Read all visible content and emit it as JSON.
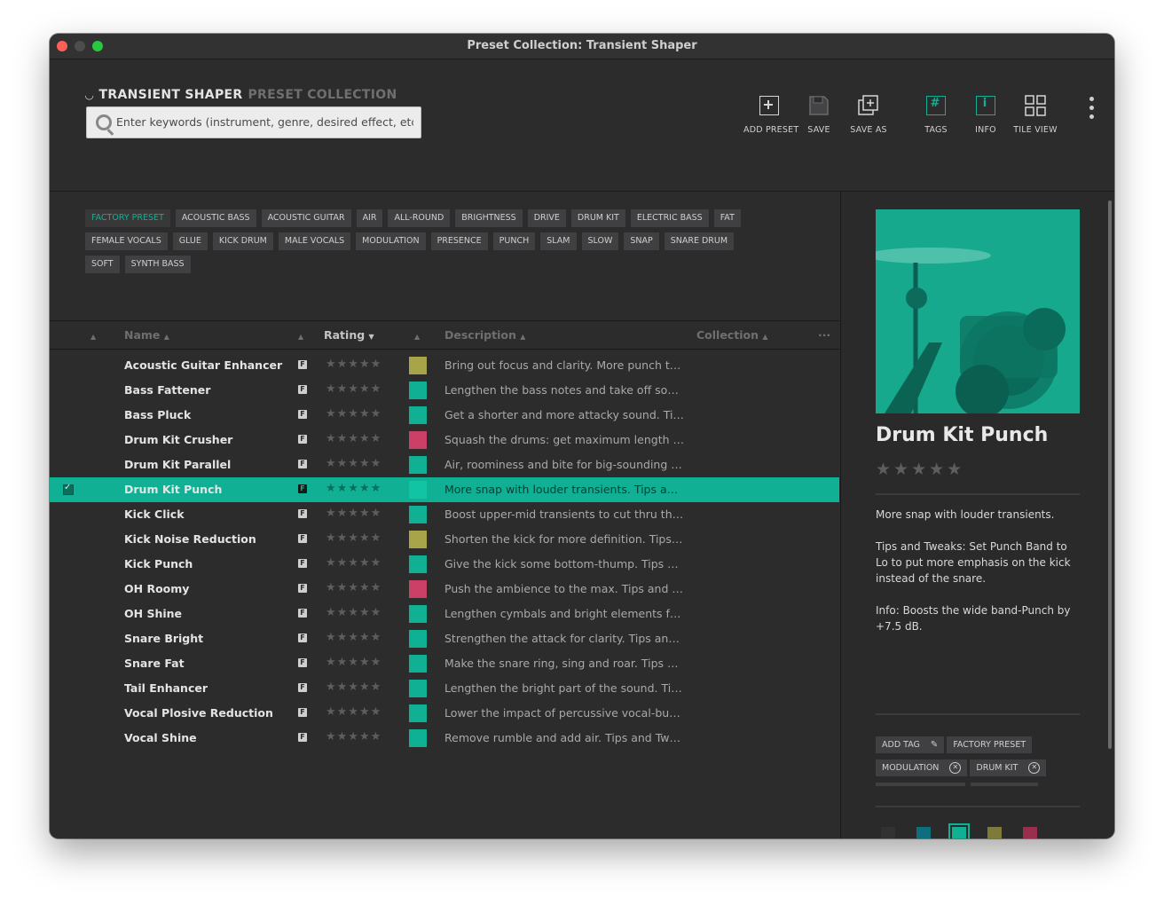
{
  "window": {
    "title": "Preset Collection: Transient Shaper"
  },
  "header": {
    "brand_name": "TRANSIENT SHAPER",
    "brand_sub": "PRESET COLLECTION",
    "search_placeholder": "Enter keywords (instrument, genre, desired effect, etc.)"
  },
  "toolbar": {
    "add_preset": "ADD PRESET",
    "save": "SAVE",
    "save_as": "SAVE AS",
    "tags": "TAGS",
    "tags_glyph": "#",
    "info": "INFO",
    "info_glyph": "i",
    "tile_view": "TILE VIEW"
  },
  "tag_filter": [
    "FACTORY PRESET",
    "ACOUSTIC BASS",
    "ACOUSTIC GUITAR",
    "AIR",
    "ALL-ROUND",
    "BRIGHTNESS",
    "DRIVE",
    "DRUM KIT",
    "ELECTRIC BASS",
    "FAT",
    "FEMALE VOCALS",
    "GLUE",
    "KICK DRUM",
    "MALE VOCALS",
    "MODULATION",
    "PRESENCE",
    "PUNCH",
    "SLAM",
    "SLOW",
    "SNAP",
    "SNARE DRUM",
    "SOFT",
    "SYNTH BASS"
  ],
  "table": {
    "col_name": "Name",
    "col_rating": "Rating",
    "col_description": "Description",
    "col_collection": "Collection",
    "more": "···",
    "f_badge": "F",
    "star_glyphs": "★★★★★",
    "rows": [
      {
        "name": "Acoustic Guitar Enhancer",
        "desc": "Bring out focus and clarity. More punch to f...",
        "color": "#a8a548"
      },
      {
        "name": "Bass Fattener",
        "desc": "Lengthen the bass notes and take off some...",
        "color": "#10b095"
      },
      {
        "name": "Bass Pluck",
        "desc": "Get a shorter and more attacky sound.  Tips...",
        "color": "#10b095"
      },
      {
        "name": "Drum Kit Crusher",
        "desc": "Squash the drums: get maximum length an...",
        "color": "#cc3f66"
      },
      {
        "name": "Drum Kit Parallel",
        "desc": "Air, roominess and bite for big-sounding dr...",
        "color": "#10b095"
      },
      {
        "name": "Drum Kit Punch",
        "desc": "More snap with louder transients.  Tips and ...",
        "color": "#10b095"
      },
      {
        "name": "Kick Click",
        "desc": "Boost upper-mid transients to cut thru the ...",
        "color": "#10b095"
      },
      {
        "name": "Kick Noise Reduction",
        "desc": "Shorten the kick for more definition.  Tips a...",
        "color": "#a8a548"
      },
      {
        "name": "Kick Punch",
        "desc": "Give the kick some bottom-thump.  Tips an...",
        "color": "#10b095"
      },
      {
        "name": "OH Roomy",
        "desc": "Push the ambience to the max.  Tips and Tw...",
        "color": "#cc3f66"
      },
      {
        "name": "OH Shine",
        "desc": "Lengthen cymbals and bright elements for ...",
        "color": "#10b095"
      },
      {
        "name": "Snare Bright",
        "desc": "Strengthen the attack for clarity.  Tips and ...",
        "color": "#10b095"
      },
      {
        "name": "Snare Fat",
        "desc": "Make the snare ring, sing and roar.  Tips an...",
        "color": "#10b095"
      },
      {
        "name": "Tail Enhancer",
        "desc": "Lengthen the bright part of the sound.  Tip...",
        "color": "#10b095"
      },
      {
        "name": "Vocal Plosive Reduction",
        "desc": "Lower the impact of percussive vocal-bum...",
        "color": "#10b095"
      },
      {
        "name": "Vocal Shine",
        "desc": "Remove rumble and add air.  Tips and Twea...",
        "color": "#10b095"
      }
    ]
  },
  "preset": {
    "title": "Drum Kit Punch",
    "rating": 0,
    "desc1": "More snap with louder transients.",
    "desc2": "Tips and Tweaks: Set Punch Band to Lo to put more emphasis on the kick instead of the snare.",
    "desc3": "Info: Boosts the wide band-Punch by +7.5 dB.",
    "add_tag": "ADD TAG",
    "tags": [
      "FACTORY PRESET",
      "MODULATION",
      "DRUM KIT"
    ],
    "colors": [
      "#323233",
      "#0d6f7d",
      "#10b095",
      "#7d7a3a",
      "#9a2f4d"
    ],
    "selected_color": "#10b095"
  }
}
